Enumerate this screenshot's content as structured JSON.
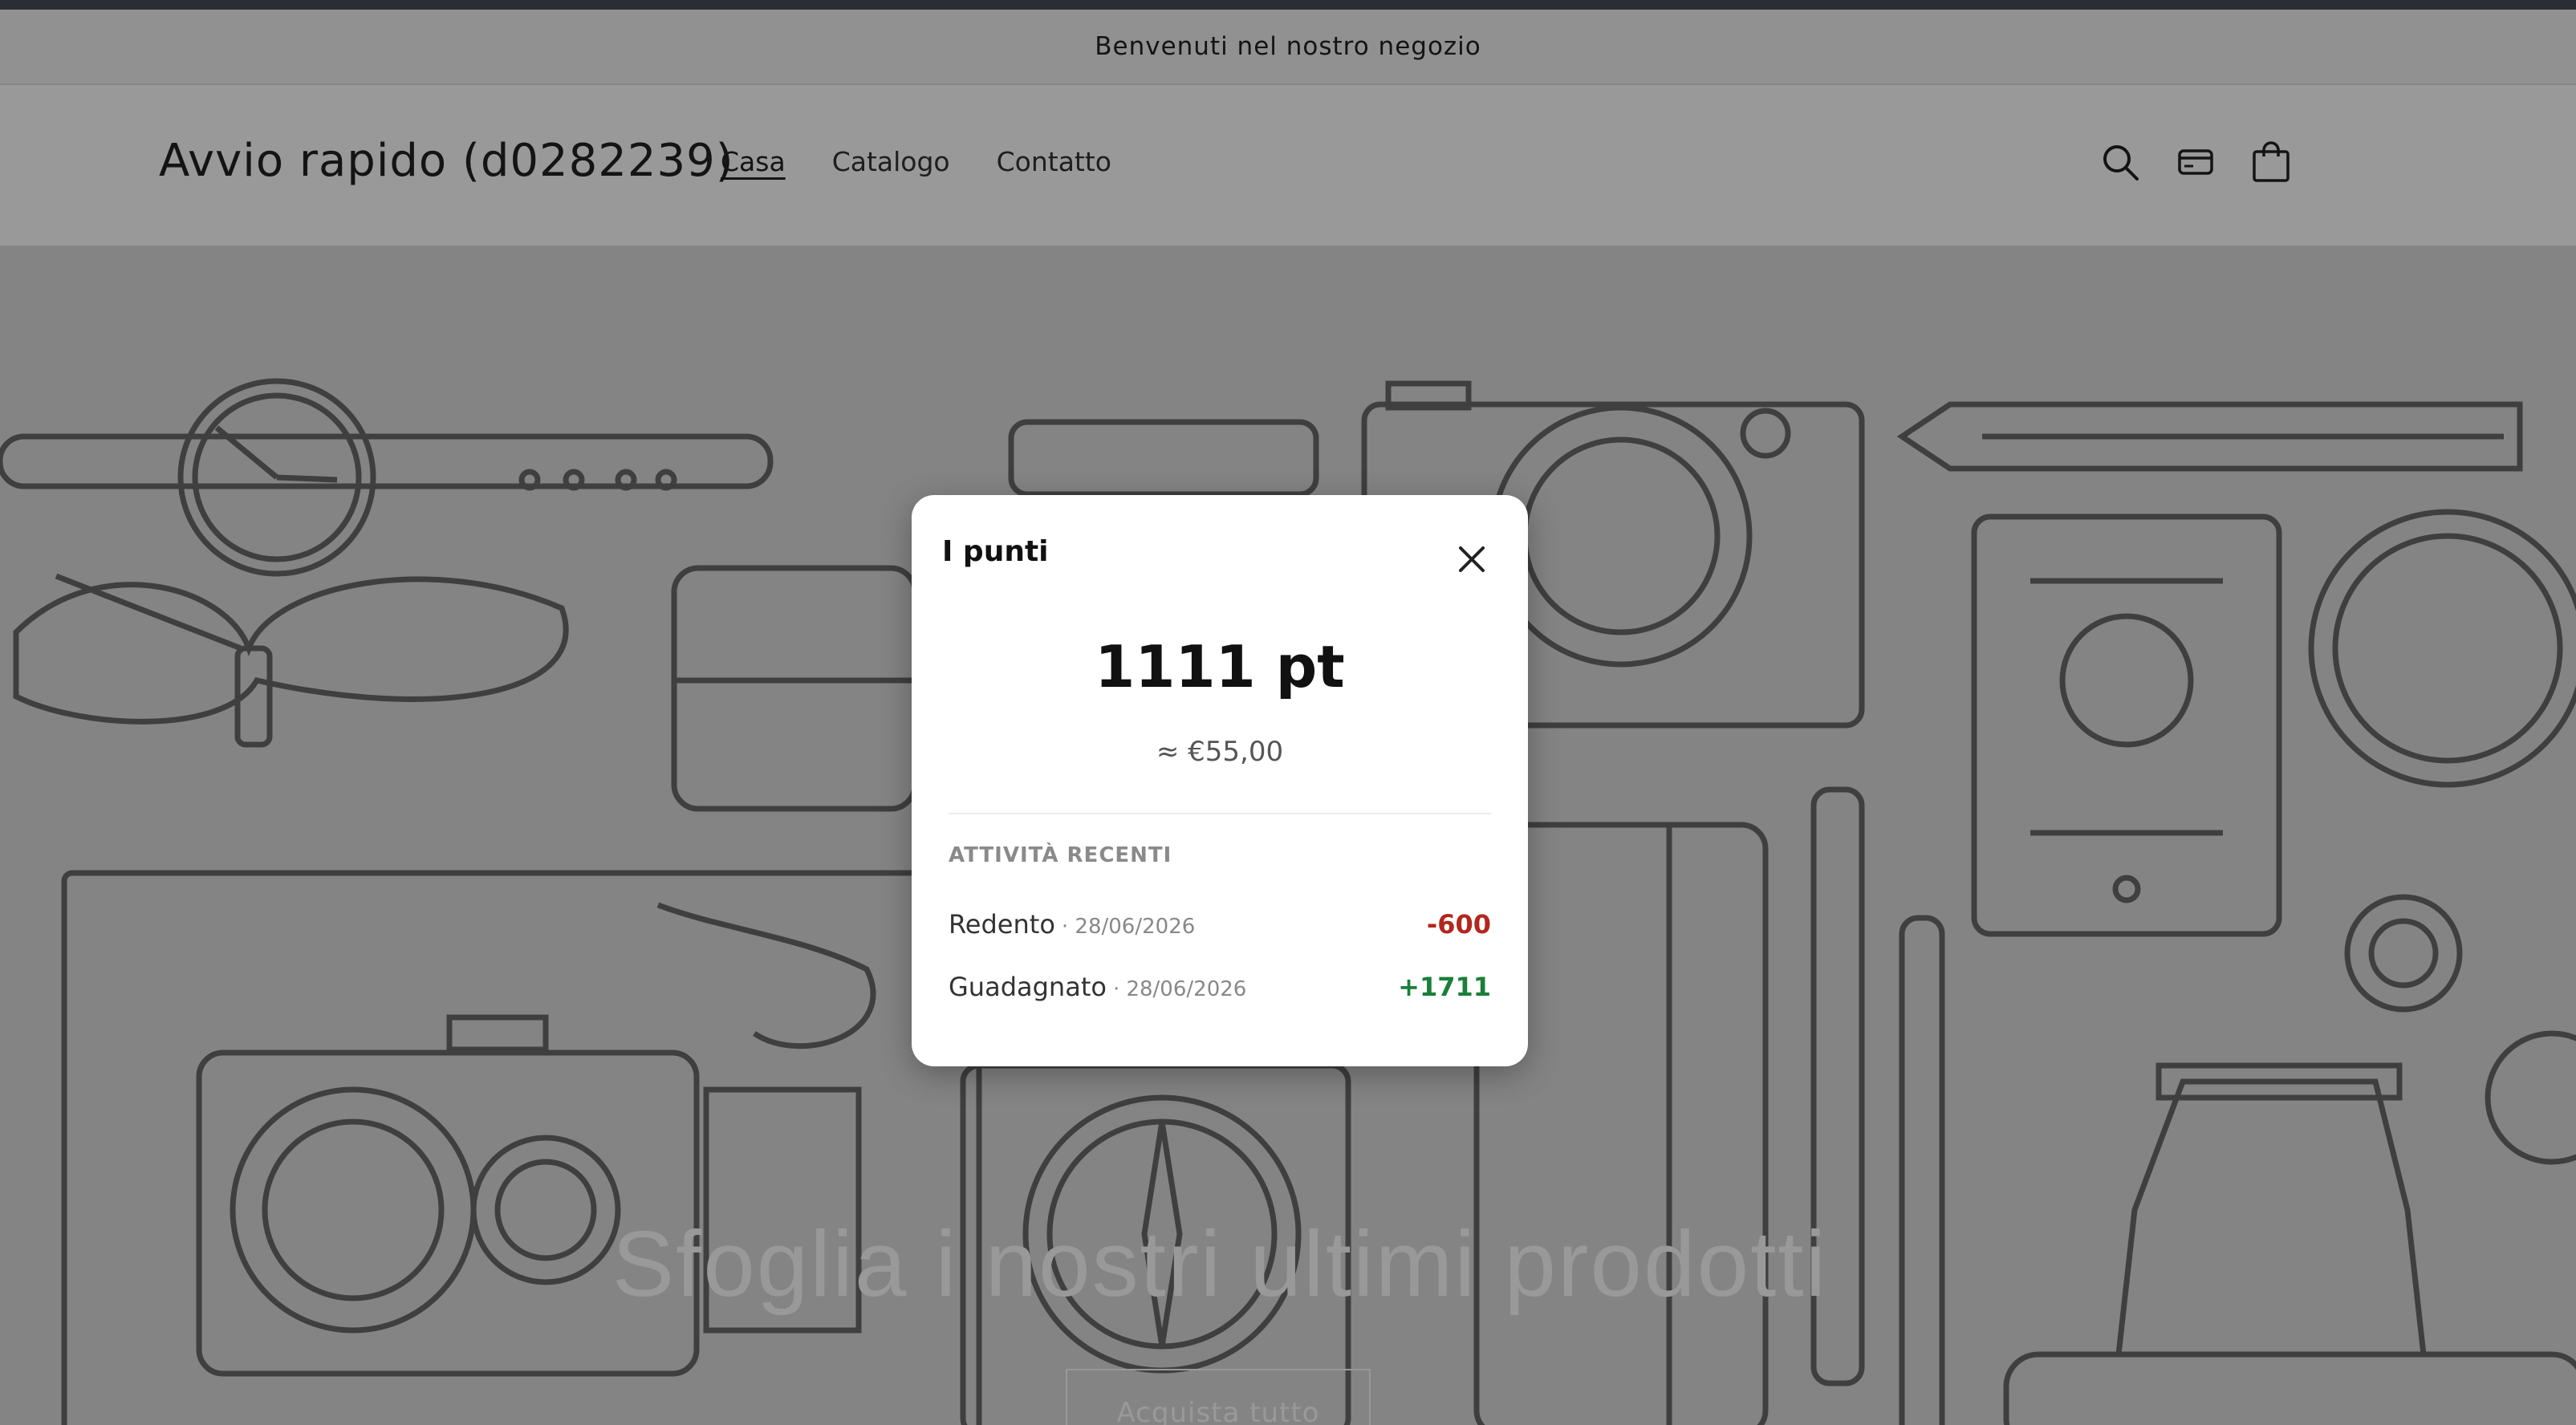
{
  "announcement": "Benvenuti nel nostro negozio",
  "header": {
    "brand": "Avvio rapido (d0282239)",
    "nav": [
      {
        "label": "Casa",
        "active": true
      },
      {
        "label": "Catalogo",
        "active": false
      },
      {
        "label": "Contatto",
        "active": false
      }
    ],
    "icons": [
      "search-icon",
      "card-icon",
      "bag-icon"
    ]
  },
  "hero": {
    "title": "Sfoglia i nostri ultimi prodotti",
    "button": "Acquista tutto"
  },
  "modal": {
    "title": "I punti",
    "points": "1111 pt",
    "euro": "≈ €55,00",
    "section_label": "ATTIVITÀ RECENTI",
    "activities": [
      {
        "type": "Redento",
        "date": "· 28/06/2026",
        "value": "-600",
        "kind": "negative"
      },
      {
        "type": "Guadagnato",
        "date": "· 28/06/2026",
        "value": "+1711",
        "kind": "positive"
      }
    ]
  },
  "colors": {
    "negative": "#b3261e",
    "positive": "#1a7f3a",
    "overlay": "rgba(0,0,0,0.40)"
  }
}
